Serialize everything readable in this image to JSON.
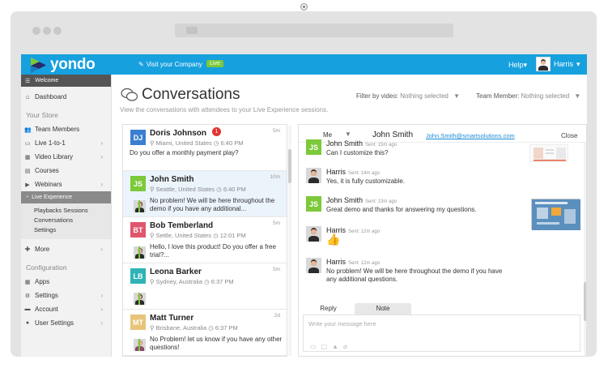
{
  "app": {
    "brand": "yondo",
    "visit_company": "Visit your Company",
    "live_badge": "Live",
    "help": "Help",
    "user_name": "Harris"
  },
  "sidebar": {
    "welcome": "Welcome",
    "dashboard": "Dashboard",
    "store_heading": "Your Store",
    "store_items": [
      {
        "label": "Team Members",
        "chevron": false
      },
      {
        "label": "Live 1-to-1",
        "chevron": true
      },
      {
        "label": "Video Library",
        "chevron": true
      },
      {
        "label": "Courses",
        "chevron": false
      },
      {
        "label": "Webinars",
        "chevron": true
      }
    ],
    "live_experience": "Live Experience",
    "live_sub": [
      "Playbacks Sessions",
      "Conversations",
      "Settings"
    ],
    "more": "More",
    "config_heading": "Configuration",
    "config_items": [
      {
        "label": "Apps",
        "chevron": false
      },
      {
        "label": "Settings",
        "chevron": true
      },
      {
        "label": "Account",
        "chevron": true
      },
      {
        "label": "User Settings",
        "chevron": true
      }
    ]
  },
  "main": {
    "title": "Conversations",
    "subtitle": "View the conversations with attendees to your Live Experience  sessions.",
    "filter_video_label": "Filter by video:",
    "filter_video_value": "Nothing selected",
    "filter_member_label": "Team Member:",
    "filter_member_value": "Nothing selected"
  },
  "conversations": [
    {
      "initials": "DJ",
      "color": "#3b7fd0",
      "name": "Doris Johnson",
      "location": "Miami, United States",
      "time": "6:40 PM",
      "ago": "5m",
      "badge": "1",
      "message": "Do you offer a monthly payment play?",
      "has_reply_avatar": false,
      "reply_gender": ""
    },
    {
      "initials": "JS",
      "color": "#7cc93a",
      "name": "John Smith",
      "location": "Seattle, United States",
      "time": "6:40 PM",
      "ago": "10m",
      "badge": "",
      "message": "No problem! We will be here throughout the demo if you have any additional...",
      "has_reply_avatar": true,
      "reply_gender": "m"
    },
    {
      "initials": "BT",
      "color": "#e0566d",
      "name": "Bob Temberland",
      "location": "Settle, United States",
      "time": "12:01 PM",
      "ago": "5m",
      "badge": "",
      "message": "Hello, I love this product! Do you offer a free trial?...",
      "has_reply_avatar": true,
      "reply_gender": "m2"
    },
    {
      "initials": "LB",
      "color": "#2fb3b6",
      "name": "Leona Barker",
      "location": "Sydney, Australia",
      "time": "6:37 PM",
      "ago": "5m",
      "badge": "",
      "message": "",
      "has_reply_avatar": true,
      "reply_gender": "m"
    },
    {
      "initials": "MT",
      "color": "#e8c47a",
      "name": "Matt Turner",
      "location": "Brisbane, Australia",
      "time": "6:37 PM",
      "ago": "2d",
      "badge": "",
      "message": "No Problem! let us know if you have any other questions!",
      "has_reply_avatar": true,
      "reply_gender": "f"
    }
  ],
  "chat": {
    "me": "Me",
    "name": "John Smith",
    "email": "John.Smith@smartsolutions.com",
    "close": "Close",
    "messages": [
      {
        "sender": "John Smith",
        "type": "js",
        "sent": "Sent: 15m ago",
        "text": "Can I customize this?"
      },
      {
        "sender": "Harris",
        "type": "h",
        "sent": "Sent: 14m ago",
        "text": "Yes, it is fully customizable."
      },
      {
        "sender": "John Smith",
        "type": "js",
        "sent": "Sent: 13m ago",
        "text": "Great demo and thanks for answering my questions."
      },
      {
        "sender": "Harris",
        "type": "h",
        "sent": "Sent: 12m ago",
        "text": "👍"
      },
      {
        "sender": "Harris",
        "type": "h",
        "sent": "Sent: 12m ago",
        "text": "No problem! We will be here throughout the demo if you have any additional questions."
      }
    ],
    "tab_reply": "Reply",
    "tab_note": "Note",
    "placeholder": "Write your message here"
  }
}
